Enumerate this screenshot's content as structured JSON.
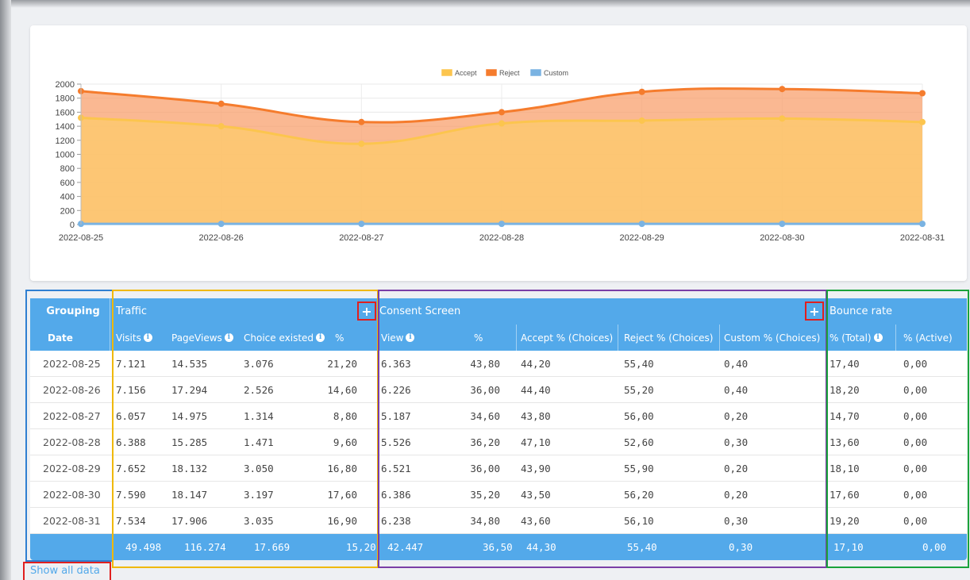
{
  "chart_data": {
    "type": "area",
    "categories": [
      "2022-08-25",
      "2022-08-26",
      "2022-08-27",
      "2022-08-28",
      "2022-08-29",
      "2022-08-30",
      "2022-08-31"
    ],
    "series": [
      {
        "name": "Accept",
        "values": [
          1520,
          1400,
          1150,
          1440,
          1480,
          1510,
          1460
        ],
        "color": "#fcc54e"
      },
      {
        "name": "Reject",
        "values": [
          1900,
          1720,
          1460,
          1600,
          1890,
          1930,
          1870
        ],
        "color": "#f57c2d"
      },
      {
        "name": "Custom",
        "values": [
          10,
          10,
          10,
          10,
          10,
          10,
          10
        ],
        "color": "#7ab3e2"
      }
    ],
    "y_ticks": [
      "0",
      "200",
      "400",
      "600",
      "800",
      "1000",
      "1200",
      "1400",
      "1600",
      "1800",
      "2000"
    ],
    "ylim": [
      0,
      2000
    ],
    "legend_position": "top-center"
  },
  "table": {
    "group_row": {
      "grouping": "Grouping",
      "traffic": "Traffic",
      "consent": "Consent Screen",
      "bounce": "Bounce rate"
    },
    "headers": {
      "date": "Date",
      "visits": "Visits",
      "pageviews": "PageViews",
      "choice": "Choice existed",
      "pct": "%",
      "view": "View",
      "view_pct": "%",
      "accept": "Accept % (Choices)",
      "reject": "Reject % (Choices)",
      "custom": "Custom % (Choices)",
      "total": "% (Total)",
      "active": "% (Active)"
    },
    "rows": [
      {
        "date": "2022-08-25",
        "visits": "7.121",
        "pageviews": "14.535",
        "choice": "3.076",
        "pct": "21,20",
        "view": "6.363",
        "view_pct": "43,80",
        "accept": "44,20",
        "reject": "55,40",
        "custom": "0,40",
        "total": "17,40",
        "active": "0,00"
      },
      {
        "date": "2022-08-26",
        "visits": "7.156",
        "pageviews": "17.294",
        "choice": "2.526",
        "pct": "14,60",
        "view": "6.226",
        "view_pct": "36,00",
        "accept": "44,40",
        "reject": "55,20",
        "custom": "0,40",
        "total": "18,20",
        "active": "0,00"
      },
      {
        "date": "2022-08-27",
        "visits": "6.057",
        "pageviews": "14.975",
        "choice": "1.314",
        "pct": "8,80",
        "view": "5.187",
        "view_pct": "34,60",
        "accept": "43,80",
        "reject": "56,00",
        "custom": "0,20",
        "total": "14,70",
        "active": "0,00"
      },
      {
        "date": "2022-08-28",
        "visits": "6.388",
        "pageviews": "15.285",
        "choice": "1.471",
        "pct": "9,60",
        "view": "5.526",
        "view_pct": "36,20",
        "accept": "47,10",
        "reject": "52,60",
        "custom": "0,30",
        "total": "13,60",
        "active": "0,00"
      },
      {
        "date": "2022-08-29",
        "visits": "7.652",
        "pageviews": "18.132",
        "choice": "3.050",
        "pct": "16,80",
        "view": "6.521",
        "view_pct": "36,00",
        "accept": "43,90",
        "reject": "55,90",
        "custom": "0,20",
        "total": "18,10",
        "active": "0,00"
      },
      {
        "date": "2022-08-30",
        "visits": "7.590",
        "pageviews": "18.147",
        "choice": "3.197",
        "pct": "17,60",
        "view": "6.386",
        "view_pct": "35,20",
        "accept": "43,50",
        "reject": "56,20",
        "custom": "0,20",
        "total": "17,60",
        "active": "0,00"
      },
      {
        "date": "2022-08-31",
        "visits": "7.534",
        "pageviews": "17.906",
        "choice": "3.035",
        "pct": "16,90",
        "view": "6.238",
        "view_pct": "34,80",
        "accept": "43,60",
        "reject": "56,10",
        "custom": "0,30",
        "total": "19,20",
        "active": "0,00"
      }
    ],
    "footer": {
      "visits": "49.498",
      "pageviews": "116.274",
      "choice": "17.669",
      "pct": "15,20",
      "view": "42.447",
      "view_pct": "36,50",
      "accept": "44,30",
      "reject": "55,40",
      "custom": "0,30",
      "total": "17,10",
      "active": "0,00"
    }
  },
  "buttons": {
    "expand_traffic": "+",
    "expand_consent": "+"
  },
  "links": {
    "show_all": "Show all data"
  },
  "colors": {
    "header_blue": "#53a9ea",
    "traffic_box": "#f0b800",
    "consent_box": "#7a3ea6",
    "bounce_box": "#1aa23a",
    "grouping_box": "#2f7fd1",
    "highlight_red": "#e0201f"
  }
}
